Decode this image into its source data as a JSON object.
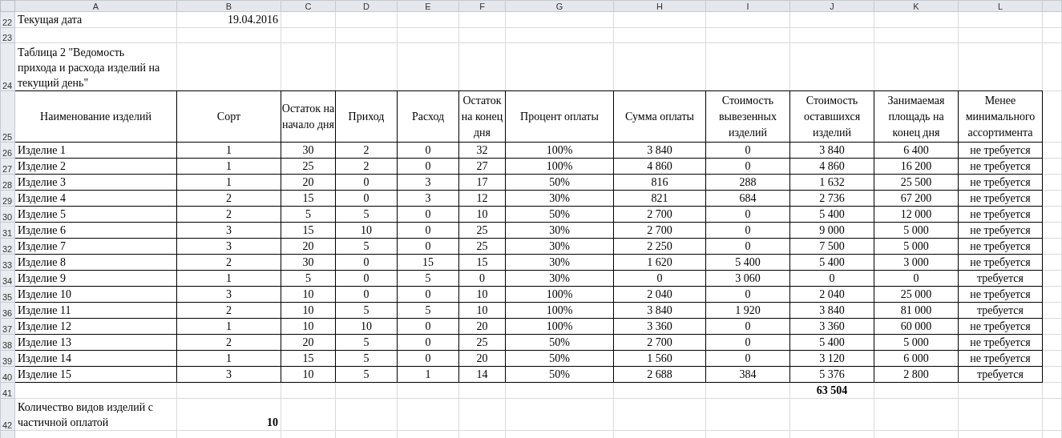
{
  "column_headers": [
    "A",
    "B",
    "C",
    "D",
    "E",
    "F",
    "G",
    "H",
    "I",
    "J",
    "K",
    "L"
  ],
  "rows": [
    {
      "number": "22",
      "kind": "info",
      "label": "Текущая дата",
      "value": "19.04.2016"
    },
    {
      "number": "23",
      "kind": "blank"
    },
    {
      "number": "24",
      "kind": "caption",
      "text": "Таблица 2 \"Ведомость прихода и расхода изделий на текущий день\""
    },
    {
      "number": "25",
      "kind": "header",
      "cells": [
        "Наименование изделий",
        "Сорт",
        "Остаток на начало дня",
        "Приход",
        "Расход",
        "Остаток на конец дня",
        "Процент оплаты",
        "Сумма оплаты",
        "Стоимость вывезенных изделий",
        "Стоимость оставшихся изделий",
        "Занимаемая площадь на конец дня",
        "Менее минимального ассортимента"
      ]
    },
    {
      "number": "26",
      "kind": "data",
      "cells": [
        "Изделие 1",
        "1",
        "30",
        "2",
        "0",
        "32",
        "100%",
        "3 840",
        "0",
        "3 840",
        "6 400",
        "не требуется"
      ]
    },
    {
      "number": "27",
      "kind": "data",
      "cells": [
        "Изделие 2",
        "1",
        "25",
        "2",
        "0",
        "27",
        "100%",
        "4 860",
        "0",
        "4 860",
        "16 200",
        "не требуется"
      ]
    },
    {
      "number": "28",
      "kind": "data",
      "cells": [
        "Изделие 3",
        "1",
        "20",
        "0",
        "3",
        "17",
        "50%",
        "816",
        "288",
        "1 632",
        "25 500",
        "не требуется"
      ]
    },
    {
      "number": "29",
      "kind": "data",
      "cells": [
        "Изделие 4",
        "2",
        "15",
        "0",
        "3",
        "12",
        "30%",
        "821",
        "684",
        "2 736",
        "67 200",
        "не требуется"
      ]
    },
    {
      "number": "30",
      "kind": "data",
      "cells": [
        "Изделие 5",
        "2",
        "5",
        "5",
        "0",
        "10",
        "50%",
        "2 700",
        "0",
        "5 400",
        "12 000",
        "не требуется"
      ]
    },
    {
      "number": "31",
      "kind": "data",
      "cells": [
        "Изделие 6",
        "3",
        "15",
        "10",
        "0",
        "25",
        "30%",
        "2 700",
        "0",
        "9 000",
        "5 000",
        "не требуется"
      ]
    },
    {
      "number": "32",
      "kind": "data",
      "cells": [
        "Изделие 7",
        "3",
        "20",
        "5",
        "0",
        "25",
        "30%",
        "2 250",
        "0",
        "7 500",
        "5 000",
        "не требуется"
      ]
    },
    {
      "number": "33",
      "kind": "data",
      "cells": [
        "Изделие 8",
        "2",
        "30",
        "0",
        "15",
        "15",
        "30%",
        "1 620",
        "5 400",
        "5 400",
        "3 000",
        "не требуется"
      ]
    },
    {
      "number": "34",
      "kind": "data",
      "cells": [
        "Изделие 9",
        "1",
        "5",
        "0",
        "5",
        "0",
        "30%",
        "0",
        "3 060",
        "0",
        "0",
        "требуется"
      ]
    },
    {
      "number": "35",
      "kind": "data",
      "cells": [
        "Изделие 10",
        "3",
        "10",
        "0",
        "0",
        "10",
        "100%",
        "2 040",
        "0",
        "2 040",
        "25 000",
        "не требуется"
      ]
    },
    {
      "number": "36",
      "kind": "data",
      "cells": [
        "Изделие 11",
        "2",
        "10",
        "5",
        "5",
        "10",
        "100%",
        "3 840",
        "1 920",
        "3 840",
        "81 000",
        "требуется"
      ]
    },
    {
      "number": "37",
      "kind": "data",
      "cells": [
        "Изделие 12",
        "1",
        "10",
        "10",
        "0",
        "20",
        "100%",
        "3 360",
        "0",
        "3 360",
        "60 000",
        "не требуется"
      ]
    },
    {
      "number": "38",
      "kind": "data",
      "cells": [
        "Изделие 13",
        "2",
        "20",
        "5",
        "0",
        "25",
        "50%",
        "2 700",
        "0",
        "5 400",
        "5 000",
        "не требуется"
      ]
    },
    {
      "number": "39",
      "kind": "data",
      "cells": [
        "Изделие 14",
        "1",
        "15",
        "5",
        "0",
        "20",
        "50%",
        "1 560",
        "0",
        "3 120",
        "6 000",
        "не требуется"
      ]
    },
    {
      "number": "40",
      "kind": "data",
      "cells": [
        "Изделие 15",
        "3",
        "10",
        "5",
        "1",
        "14",
        "50%",
        "2 688",
        "384",
        "5 376",
        "2 800",
        "требуется"
      ]
    },
    {
      "number": "41",
      "kind": "total",
      "cells": [
        null,
        null,
        null,
        null,
        null,
        null,
        null,
        null,
        null,
        "63 504",
        null,
        null
      ]
    },
    {
      "number": "42",
      "kind": "summary",
      "label": "Количество видов изделий с частичной оплатой",
      "value": "10"
    },
    {
      "kind": "blank"
    }
  ]
}
